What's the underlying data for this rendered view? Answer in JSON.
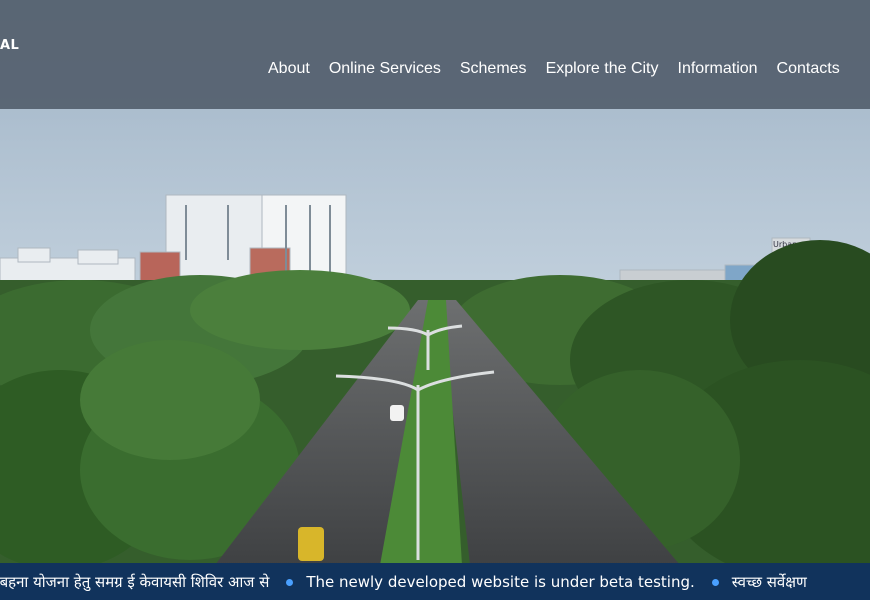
{
  "header": {
    "logo_fragment": "AL",
    "nav": [
      {
        "label": "About"
      },
      {
        "label": "Online Services"
      },
      {
        "label": "Schemes"
      },
      {
        "label": "Explore the City"
      },
      {
        "label": "Information"
      },
      {
        "label": "Contacts"
      }
    ]
  },
  "hero": {
    "building_sign": "Urban"
  },
  "ticker": {
    "items": [
      "ी बहना योजना हेतु समग्र ई केवायसी शिविर आज से",
      "The newly developed website is under beta testing.",
      "स्वच्छ सर्वेक्षण"
    ]
  },
  "colors": {
    "header_bg": "#54606e",
    "ticker_bg": "#11335c",
    "ticker_dot": "#4aa0ff",
    "sky": "#b5c7d8",
    "foliage": "#2f5f26"
  }
}
